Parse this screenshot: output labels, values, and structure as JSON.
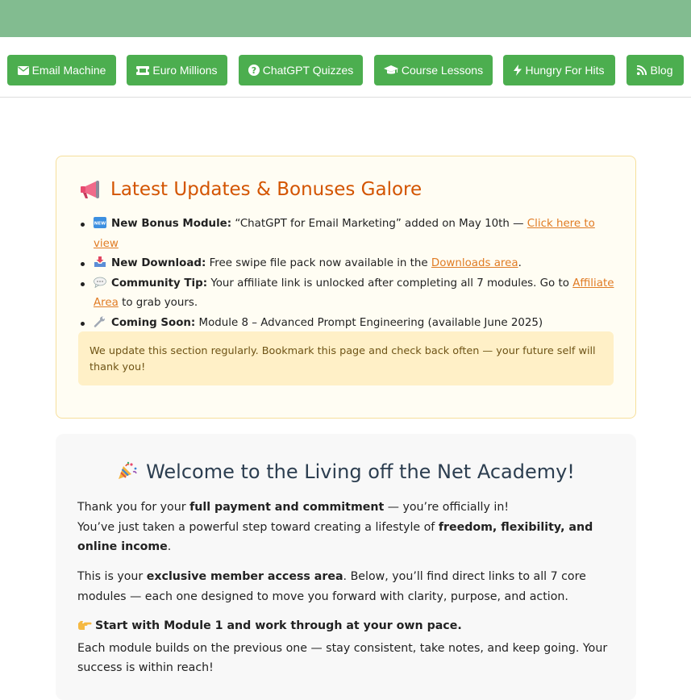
{
  "nav": {
    "items": [
      {
        "label": "Email Machine",
        "icon": "envelope-icon"
      },
      {
        "label": "Euro Millions",
        "icon": "ticket-icon"
      },
      {
        "label": "ChatGPT Quizzes",
        "icon": "question-circle-icon"
      },
      {
        "label": "Course Lessons",
        "icon": "graduation-cap-icon"
      },
      {
        "label": "Hungry For Hits",
        "icon": "bolt-icon"
      },
      {
        "label": "Blog",
        "icon": "rss-icon"
      }
    ],
    "button_color": "#4cae4f",
    "topbar_color": "#82bc90"
  },
  "updates": {
    "title": "Latest Updates & Bonuses Galore",
    "title_icon": "megaphone-icon",
    "title_color": "#d35400",
    "items": [
      {
        "icon": "new-badge-icon",
        "label": "New Bonus Module:",
        "text": "“ChatGPT for Email Marketing” added on May 10th —",
        "link": "Click here to view",
        "after": ""
      },
      {
        "icon": "inbox-tray-icon",
        "label": "New Download:",
        "text": "Free swipe file pack now available in the",
        "link": "Downloads area",
        "after": "."
      },
      {
        "icon": "speech-bubble-icon",
        "label": "Community Tip:",
        "text": "Your affiliate link is unlocked after completing all 7 modules. Go to",
        "link": "Affiliate Area",
        "after": "to grab yours."
      },
      {
        "icon": "wrench-icon",
        "label": "Coming Soon:",
        "text": "Module 8 – Advanced Prompt Engineering (available June 2025)",
        "link": "",
        "after": ""
      }
    ],
    "note": "We update this section regularly. Bookmark this page and check back often — your future self will thank you!"
  },
  "welcome": {
    "icon": "party-popper-icon",
    "title": "Welcome to the Living off the Net Academy!",
    "p1": {
      "a": "Thank you for your",
      "b": "full payment and commitment",
      "c": "— you’re officially in!",
      "d": "You’ve just taken a powerful step toward creating a lifestyle of",
      "e": "freedom, flexibility, and online income",
      "f": "."
    },
    "p2": {
      "a": "This is your",
      "b": "exclusive member access area",
      "c": ". Below, you’ll find direct links to all 7 core modules — each one designed to move you forward with clarity, purpose, and action."
    },
    "p3": {
      "icon": "pointing-hand-icon",
      "b": "Start with Module 1 and work through at your own pace.",
      "c": "Each module builds on the previous one — stay consistent, take notes, and keep going. Your success is within reach!"
    }
  }
}
